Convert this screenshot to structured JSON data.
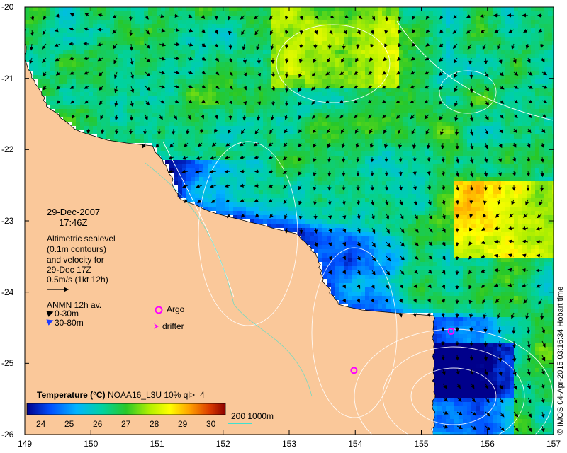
{
  "date_label": "29-Dec-2007",
  "time_label": "17:46Z",
  "altimetry_note": [
    "Altimetric sealevel",
    "(0.1m contours)",
    "and velocity for",
    "29-Dec 17Z"
  ],
  "velocity_scale_label": "0.5m/s (1kt 12h)",
  "mooring_legend": {
    "title": "ANMN 12h av.",
    "items": [
      {
        "label": "0-30m",
        "color": "#000000"
      },
      {
        "label": "30-80m",
        "color": "#1f3cff"
      }
    ]
  },
  "argo_label": "Argo",
  "drifter_label": "drifter",
  "colorbar": {
    "title": "Temperature (°C)",
    "subtitle": "NOAA16_L3U 10% ql>=4",
    "ticks": [
      "24",
      "25",
      "26",
      "27",
      "28",
      "29",
      "30"
    ],
    "range": [
      23.5,
      30.5
    ]
  },
  "bathymetry_label": "200  1000m",
  "credit": "© IMOS 04-Apr-2015 03:16:34 Hobart time",
  "axes": {
    "lon_ticks": [
      "149",
      "150",
      "151",
      "152",
      "153",
      "154",
      "155",
      "156",
      "157"
    ],
    "lat_ticks": [
      "-20",
      "-21",
      "-22",
      "-23",
      "-24",
      "-25",
      "-26"
    ],
    "lon_range": [
      149,
      157
    ],
    "lat_range": [
      -26,
      -20
    ]
  },
  "colors": {
    "land": "#fac89a",
    "contour": "#ffffff",
    "bathymetry": "#40e0d0",
    "argo": "#ff00ff",
    "drifter": "#ff00ff"
  },
  "argo_floats": [
    {
      "lon": 155.45,
      "lat": -24.55
    },
    {
      "lon": 153.98,
      "lat": -25.1
    }
  ],
  "drifters": []
}
